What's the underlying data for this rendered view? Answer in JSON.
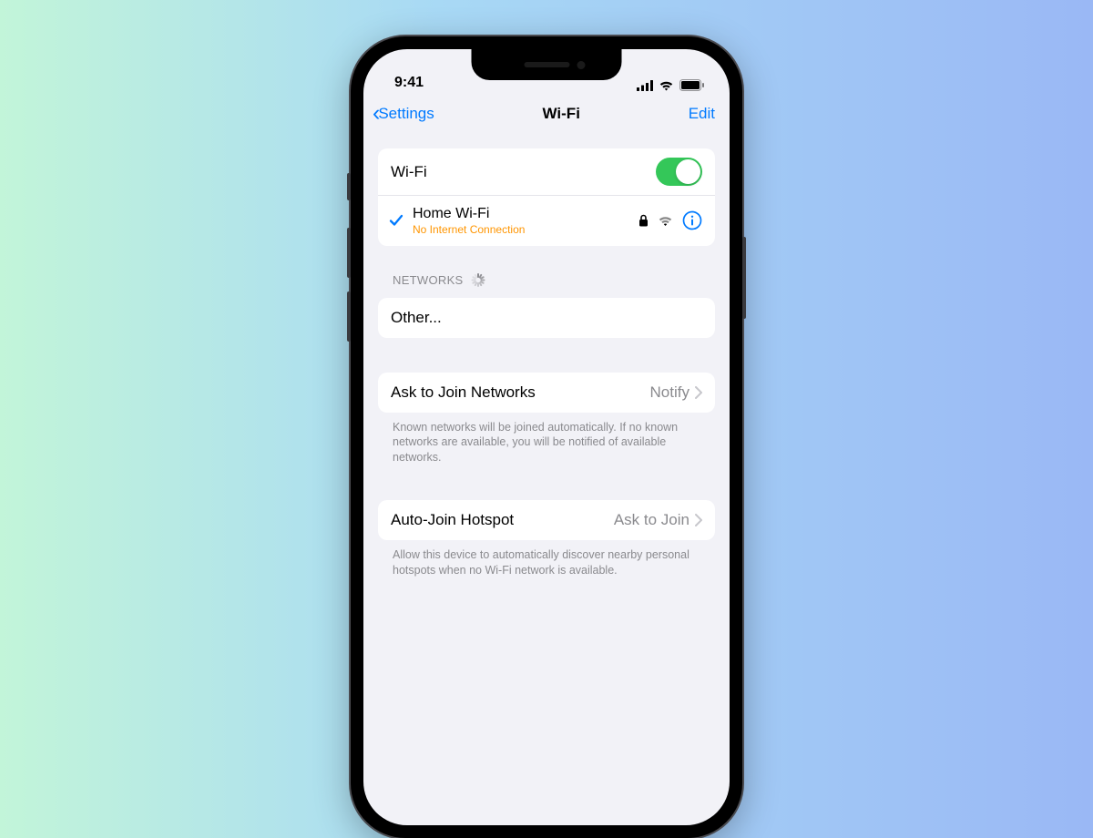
{
  "status": {
    "time": "9:41"
  },
  "nav": {
    "back": "Settings",
    "title": "Wi-Fi",
    "edit": "Edit"
  },
  "wifi": {
    "toggle_label": "Wi-Fi",
    "connected": {
      "name": "Home Wi-Fi",
      "status": "No Internet Connection"
    }
  },
  "sections": {
    "networks_header": "NETWORKS",
    "other_label": "Other..."
  },
  "ask": {
    "label": "Ask to Join Networks",
    "value": "Notify",
    "footer": "Known networks will be joined automatically. If no known networks are available, you will be notified of available networks."
  },
  "hotspot": {
    "label": "Auto-Join Hotspot",
    "value": "Ask to Join",
    "footer": "Allow this device to automatically discover nearby personal hotspots when no Wi-Fi network is available."
  }
}
